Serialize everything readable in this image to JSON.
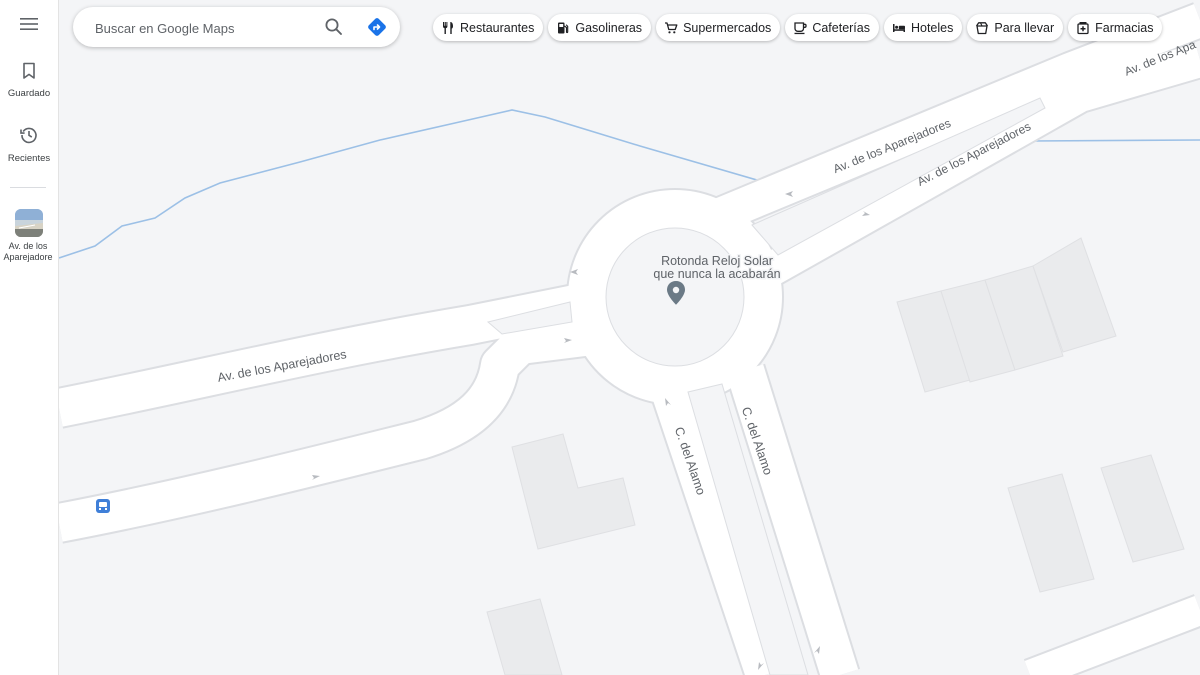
{
  "rail": {
    "saved_label": "Guardado",
    "recent_label": "Recientes",
    "recent_place_label_1": "Av. de los",
    "recent_place_label_2": "Aparejadore"
  },
  "search": {
    "placeholder": "Buscar en Google Maps"
  },
  "chips": [
    {
      "label": "Restaurantes",
      "icon": "fork-knife-icon"
    },
    {
      "label": "Gasolineras",
      "icon": "gas-pump-icon"
    },
    {
      "label": "Supermercados",
      "icon": "shopping-cart-icon"
    },
    {
      "label": "Cafeterías",
      "icon": "coffee-cup-icon"
    },
    {
      "label": "Hoteles",
      "icon": "bed-icon"
    },
    {
      "label": "Para llevar",
      "icon": "takeaway-icon"
    },
    {
      "label": "Farmacias",
      "icon": "pharmacy-icon"
    }
  ],
  "map": {
    "roundabout_label_1": "Rotonda Reloj Solar",
    "roundabout_label_2": "que nunca la acabarán",
    "road_av_aparejadores": "Av. de los Aparejadores",
    "road_av_aparejadores_top": "Av. de los Apa",
    "road_calle_alamo": "C. del Alamo",
    "colors": {
      "background": "#f4f5f7",
      "road": "#ffffff",
      "road_edge": "#dcdee2",
      "water": "#9cc0e6",
      "building": "#eaebed",
      "marker": "#6b7a86",
      "bus_stop": "#3f7fd8"
    }
  }
}
